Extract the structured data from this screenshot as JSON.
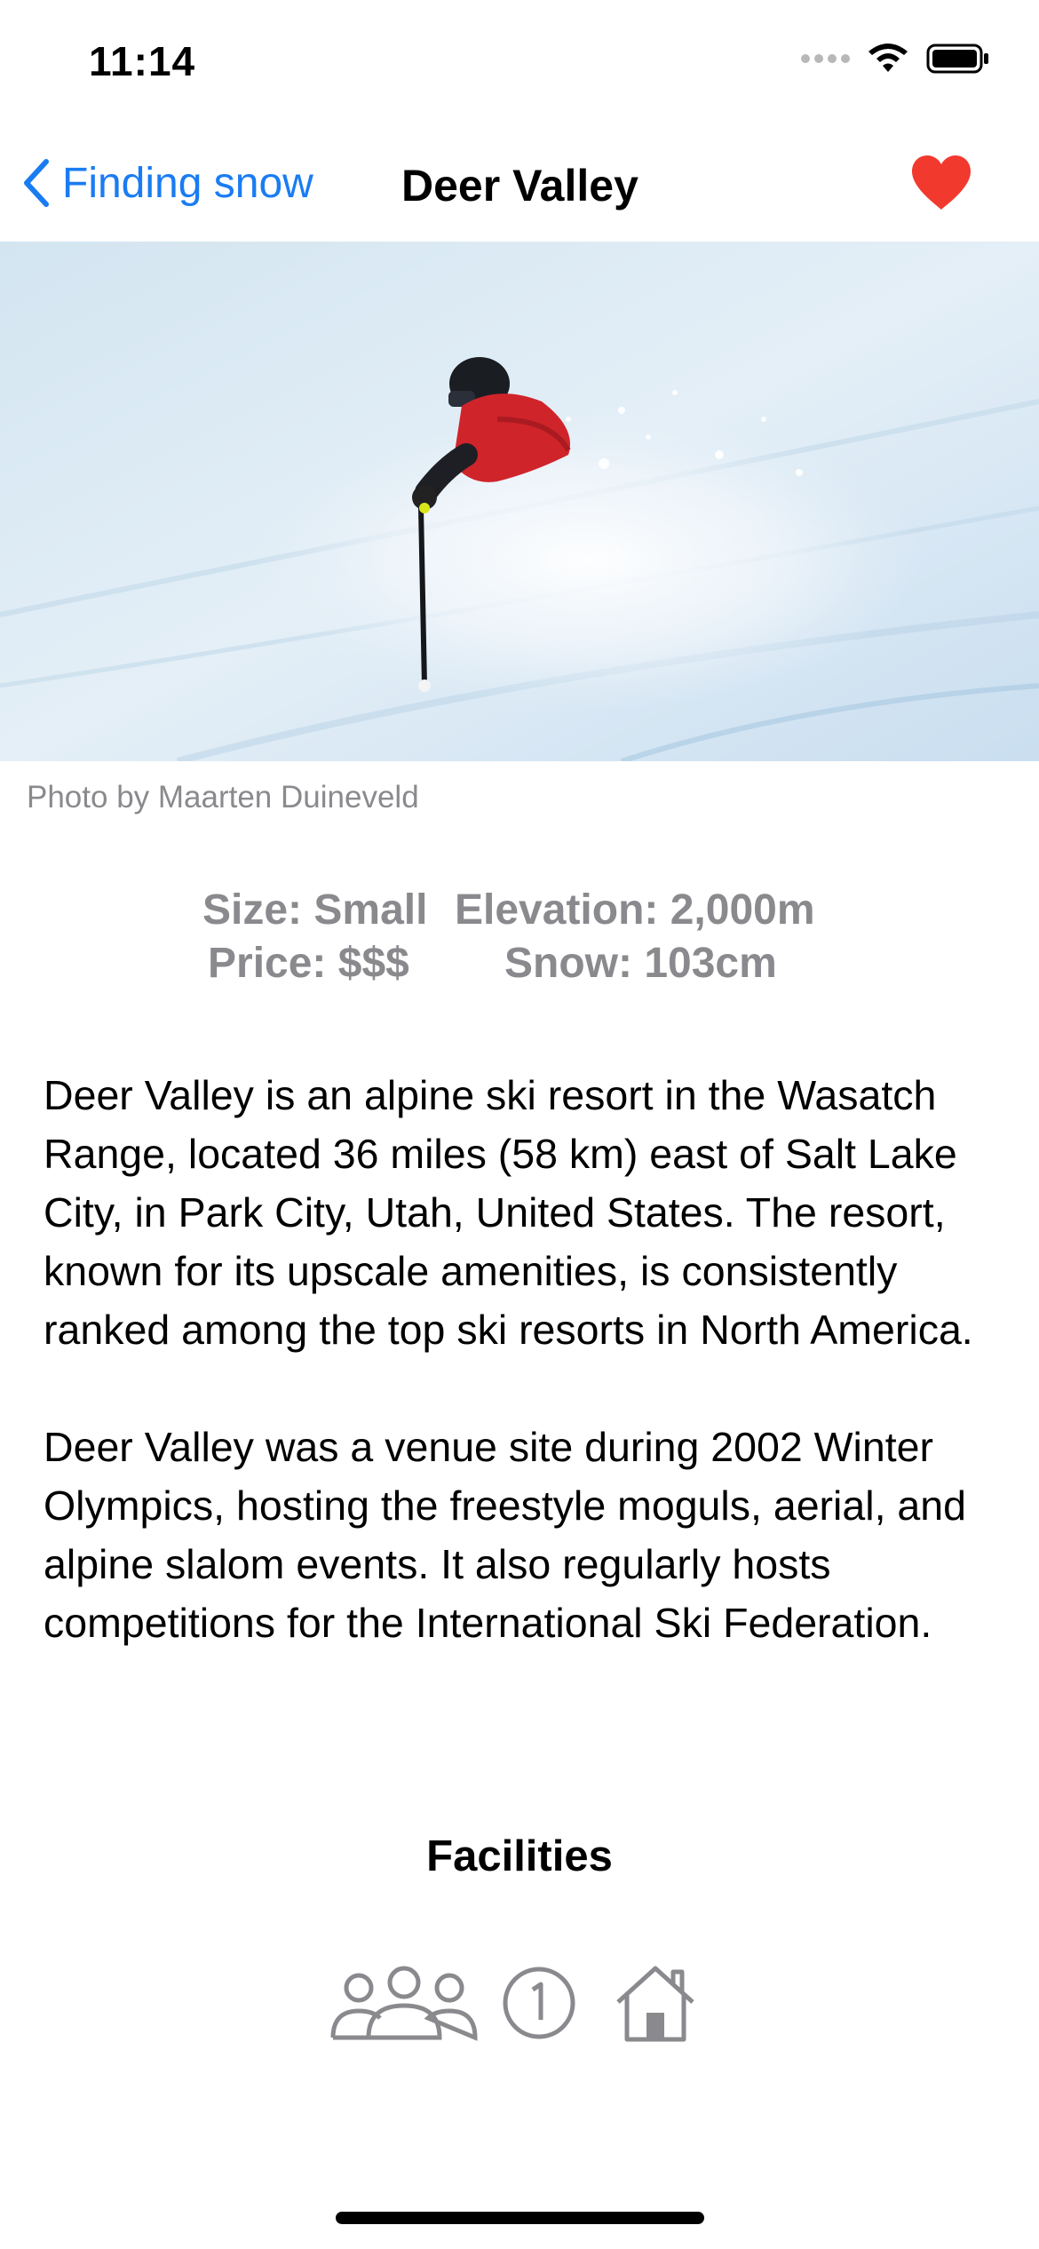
{
  "status_bar": {
    "time": "11:14",
    "icons": [
      "signal-icon",
      "wifi-icon",
      "battery-icon"
    ]
  },
  "nav": {
    "back_label": "Finding snow",
    "title": "Deer Valley",
    "favorite_icon": "heart-icon",
    "accent_color": "#1a7cf2",
    "favorite_color": "#f2392e"
  },
  "hero": {
    "image": "skier-in-powder-snow",
    "credit": "Photo by Maarten Duineveld"
  },
  "stats": {
    "size": "Size: Small",
    "elevation": "Elevation: 2,000m",
    "price": "Price: $$$",
    "snow": "Snow: 103cm"
  },
  "description": {
    "paragraphs": [
      "Deer Valley is an alpine ski resort in the Wasatch Range, located 36 miles (58 km) east of Salt Lake City, in Park City, Utah, United States. The resort, known for its upscale amenities, is consistently ranked among the top ski resorts in North America.",
      "Deer Valley was a venue site during 2002 Winter Olympics, hosting the freestyle moguls, aerial, and alpine slalom events. It also regularly hosts competitions for the International Ski Federation."
    ]
  },
  "facilities": {
    "heading": "Facilities",
    "icons": [
      "group-icon",
      "number-one-circle-icon",
      "house-icon"
    ]
  }
}
